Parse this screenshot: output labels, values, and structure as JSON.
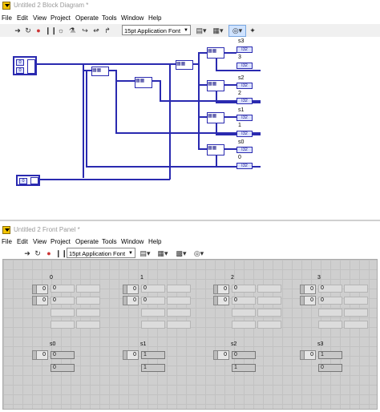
{
  "diagram_window": {
    "title": "Untitled 2 Block Diagram *",
    "menu": [
      "File",
      "Edit",
      "View",
      "Project",
      "Operate",
      "Tools",
      "Window",
      "Help"
    ],
    "font_select": "15pt Application Font",
    "wire_labels": [
      "s3",
      "3",
      "s2",
      "2",
      "s1",
      "1",
      "s0",
      "0"
    ],
    "indicator_type": "I32",
    "constant_value": "0"
  },
  "panel_window": {
    "title": "Untitled 2 Front Panel *",
    "menu": [
      "File",
      "Edit",
      "View",
      "Project",
      "Operate",
      "Tools",
      "Window",
      "Help"
    ],
    "font_select": "15pt Application Font",
    "array_labels": [
      "0",
      "1",
      "2",
      "3"
    ],
    "array_index": "0",
    "array_cells": [
      "0",
      "0",
      "0",
      "0"
    ],
    "result_labels": [
      "s0",
      "s1",
      "s2",
      "s3"
    ],
    "results": [
      [
        "0",
        "0"
      ],
      [
        "1",
        "1"
      ],
      [
        "0",
        "1"
      ],
      [
        "1",
        "0"
      ]
    ]
  },
  "colors": {
    "wire": "#2a2ab0",
    "panel": "#cfcfcf",
    "icon_yellow": "#f3c400"
  }
}
